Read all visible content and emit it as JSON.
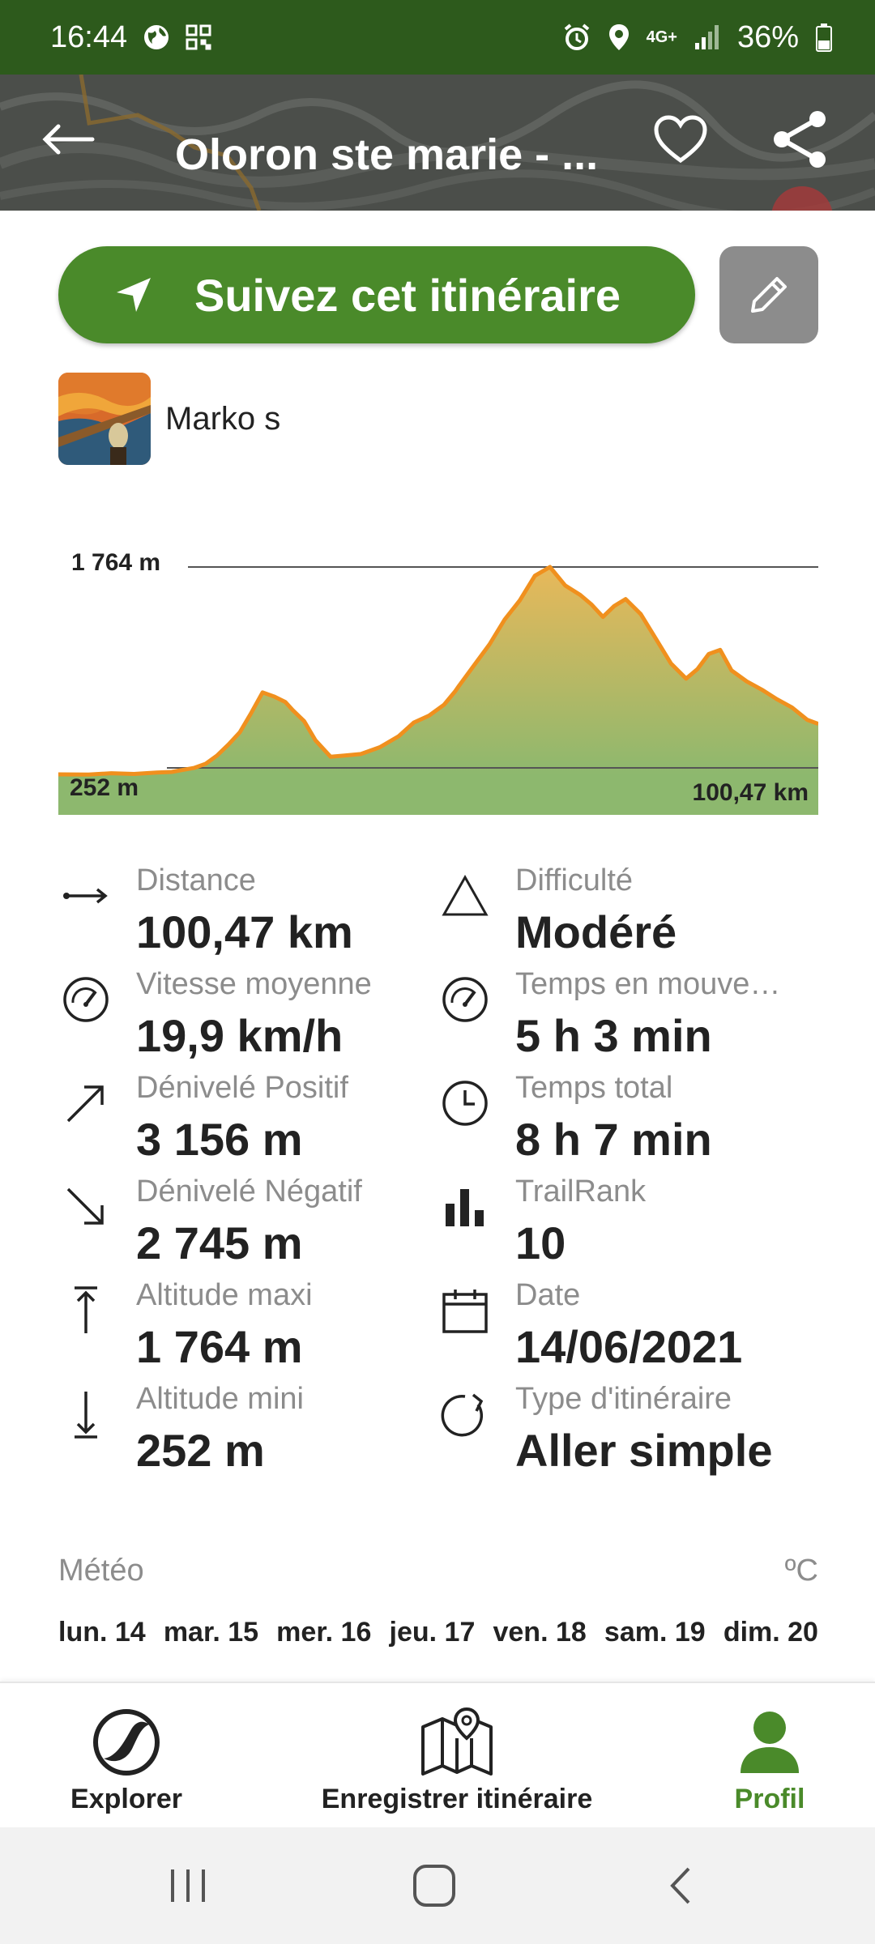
{
  "status_bar": {
    "time": "16:44",
    "network": "4G+",
    "battery": "36%",
    "icons": [
      "globe-icon",
      "qr-code-icon",
      "alarm-icon",
      "location-icon",
      "signal-icon",
      "battery-icon"
    ]
  },
  "header": {
    "title": "Oloron ste marie - ...",
    "icons": [
      "back-arrow-icon",
      "heart-icon",
      "share-icon"
    ]
  },
  "actions": {
    "follow_label": "Suivez cet itinéraire",
    "follow_icon": "navigation-arrow-icon",
    "edit_icon": "pencil-icon"
  },
  "author": {
    "name": "Marko s"
  },
  "chart_data": {
    "type": "area",
    "title": "",
    "xlabel": "",
    "ylabel": "",
    "max_label": "1 764 m",
    "min_label": "252 m",
    "distance_label": "100,47 km",
    "xlim": [
      0,
      100.47
    ],
    "ylim": [
      252,
      1764
    ],
    "x": [
      0,
      4,
      7,
      10,
      13,
      15,
      16.5,
      18,
      19.5,
      21,
      22.5,
      24,
      25.5,
      27,
      28.5,
      30,
      31,
      32.5,
      34,
      36,
      38,
      40,
      42.5,
      45,
      47,
      49,
      51,
      52.5,
      53,
      55,
      57,
      59,
      61,
      63,
      65,
      67,
      69,
      70.5,
      72,
      73.5,
      75,
      77,
      79,
      81,
      83,
      84.5,
      86,
      87.5,
      89,
      91,
      93,
      95,
      97,
      99,
      100.47
    ],
    "series": [
      {
        "values": [
          252,
          250,
          260,
          255,
          265,
          270,
          285,
          300,
          330,
          390,
          470,
          560,
          700,
          850,
          820,
          780,
          720,
          640,
          500,
          380,
          390,
          400,
          450,
          530,
          630,
          680,
          760,
          860,
          900,
          1050,
          1200,
          1380,
          1520,
          1700,
          1764,
          1630,
          1560,
          1490,
          1400,
          1480,
          1530,
          1420,
          1240,
          1060,
          950,
          1020,
          1130,
          1160,
          1010,
          930,
          870,
          800,
          740,
          650,
          620
        ]
      }
    ],
    "colors": {
      "fill_top": "#e8b85a",
      "fill_bottom": "#8db86e",
      "line": "#f0901e",
      "band": "#8db86e"
    }
  },
  "stats": [
    {
      "label": "Distance",
      "value": "100,47 km",
      "icon": "distance-icon"
    },
    {
      "label": "Difficulté",
      "value": "Modéré",
      "icon": "difficulty-triangle-icon"
    },
    {
      "label": "Vitesse moyenne",
      "value": "19,9 km/h",
      "icon": "speedometer-icon"
    },
    {
      "label": "Temps en mouve…",
      "value": "5 h 3 min",
      "icon": "moving-speedometer-icon"
    },
    {
      "label": "Dénivelé Positif",
      "value": "3 156 m",
      "icon": "elevation-gain-icon"
    },
    {
      "label": "Temps total",
      "value": "8 h 7 min",
      "icon": "clock-icon"
    },
    {
      "label": "Dénivelé Négatif",
      "value": "2 745 m",
      "icon": "elevation-loss-icon"
    },
    {
      "label": "TrailRank",
      "value": "10",
      "icon": "bar-chart-icon"
    },
    {
      "label": "Altitude maxi",
      "value": "1 764 m",
      "icon": "max-altitude-icon"
    },
    {
      "label": "Date",
      "value": "14/06/2021",
      "icon": "calendar-icon"
    },
    {
      "label": "Altitude mini",
      "value": "252 m",
      "icon": "min-altitude-icon"
    },
    {
      "label": "Type d'itinéraire",
      "value": "Aller simple",
      "icon": "one-way-icon"
    }
  ],
  "weather": {
    "title": "Météo",
    "unit": "ºC",
    "days": [
      "lun. 14",
      "mar. 15",
      "mer. 16",
      "jeu. 17",
      "ven. 18",
      "sam. 19",
      "dim. 20"
    ]
  },
  "bottom_nav": [
    {
      "label": "Explorer",
      "icon": "explore-compass-icon",
      "active": false
    },
    {
      "label": "Enregistrer itinéraire",
      "icon": "map-pin-icon",
      "active": false
    },
    {
      "label": "Profil",
      "icon": "profile-user-icon",
      "active": true
    }
  ],
  "colors": {
    "status_bar": "#2d5a1c",
    "primary_green": "#4a8a2a",
    "active_tab": "#4a8a2a",
    "muted_text": "#8c8c8c",
    "edit_button": "#8c8c8c"
  }
}
